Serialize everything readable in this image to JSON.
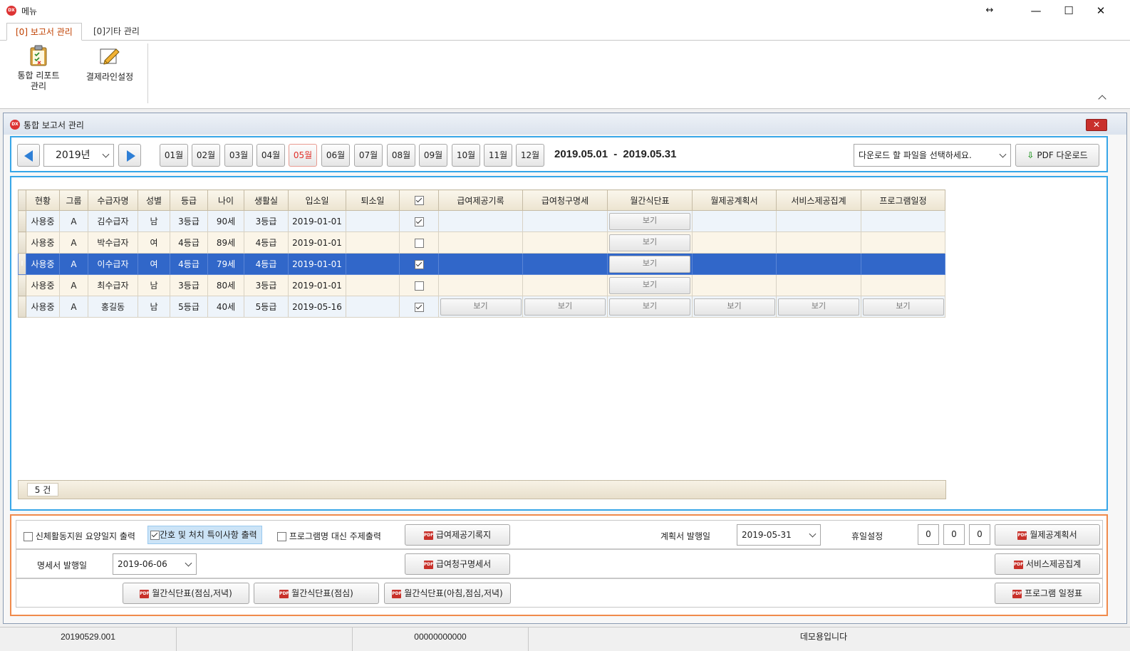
{
  "window": {
    "title": "메뉴"
  },
  "ribbon": {
    "tabs": [
      {
        "label": "[0] 보고서 관리"
      },
      {
        "label": "[0]기타 관리"
      }
    ],
    "buttons": [
      {
        "label": "통합 리포트\n관리"
      },
      {
        "label": "결제라인설정"
      }
    ]
  },
  "child": {
    "title": "통합 보고서 관리"
  },
  "toolbar": {
    "year": "2019년",
    "months": [
      "01월",
      "02월",
      "03월",
      "04월",
      "05월",
      "06월",
      "07월",
      "08월",
      "09월",
      "10월",
      "11월",
      "12월"
    ],
    "selected_month": "05월",
    "range_start": "2019.05.01",
    "range_sep": "-",
    "range_end": "2019.05.31",
    "download_select_placeholder": "다운로드 할 파일을 선택하세요.",
    "pdf_download": "PDF 다운로드"
  },
  "grid": {
    "columns": [
      "현황",
      "그룹",
      "수급자명",
      "성별",
      "등급",
      "나이",
      "생활실",
      "입소일",
      "퇴소일",
      "",
      "급여제공기록",
      "급여청구명세",
      "월간식단표",
      "월제공계획서",
      "서비스제공집계",
      "프로그램일정"
    ],
    "view_label": "보기",
    "rows": [
      {
        "status": "사용중",
        "group": "A",
        "name": "김수급자",
        "sex": "남",
        "grade": "3등급",
        "age": "90세",
        "room": "3등급",
        "admit": "2019-01-01",
        "checked": true,
        "views": [
          false,
          false,
          true,
          false,
          false,
          false
        ]
      },
      {
        "status": "사용중",
        "group": "A",
        "name": "박수급자",
        "sex": "여",
        "grade": "4등급",
        "age": "89세",
        "room": "4등급",
        "admit": "2019-01-01",
        "checked": false,
        "views": [
          false,
          false,
          true,
          false,
          false,
          false
        ]
      },
      {
        "status": "사용중",
        "group": "A",
        "name": "이수급자",
        "sex": "여",
        "grade": "4등급",
        "age": "79세",
        "room": "4등급",
        "admit": "2019-01-01",
        "checked": true,
        "views": [
          false,
          false,
          true,
          false,
          false,
          false
        ]
      },
      {
        "status": "사용중",
        "group": "A",
        "name": "최수급자",
        "sex": "남",
        "grade": "3등급",
        "age": "80세",
        "room": "3등급",
        "admit": "2019-01-01",
        "checked": false,
        "views": [
          false,
          false,
          true,
          false,
          false,
          false
        ]
      },
      {
        "status": "사용중",
        "group": "A",
        "name": "홍길동",
        "sex": "남",
        "grade": "5등급",
        "age": "40세",
        "room": "5등급",
        "admit": "2019-05-16",
        "checked": true,
        "views": [
          true,
          true,
          true,
          true,
          true,
          true
        ]
      }
    ],
    "selected_row": 2,
    "count": "5 건"
  },
  "options": {
    "cb_body_log": "신체활동지원 요양일지 출력",
    "cb_nursing": "간호 및 처치 특이사항 출력",
    "cb_subject": "프로그램명 대신 주제출력",
    "btn_benefit_record": "급여제공기록지",
    "plan_issue_label": "계획서 발행일",
    "plan_issue_date": "2019-05-31",
    "holiday_label": "휴일설정",
    "holiday_values": [
      "0",
      "0",
      "0"
    ],
    "btn_monthly_plan": "월제공계획서",
    "stmt_issue_label": "명세서 발행일",
    "stmt_issue_date": "2019-06-06",
    "btn_claim_stmt": "급여청구명세서",
    "btn_service_sum": "서비스제공집계",
    "btn_menu_ld": "월간식단표(점심,저녁)",
    "btn_menu_l": "월간식단표(점심)",
    "btn_menu_bld": "월간식단표(아침,점심,저녁)",
    "btn_program": "프로그램 일정표"
  },
  "status": {
    "version": "20190529.001",
    "code": "00000000000",
    "notice": "데모용입니다"
  },
  "colors": {
    "accent_blue": "#37a6e8",
    "accent_orange": "#f08a4b",
    "selected_row": "#3167c9"
  }
}
